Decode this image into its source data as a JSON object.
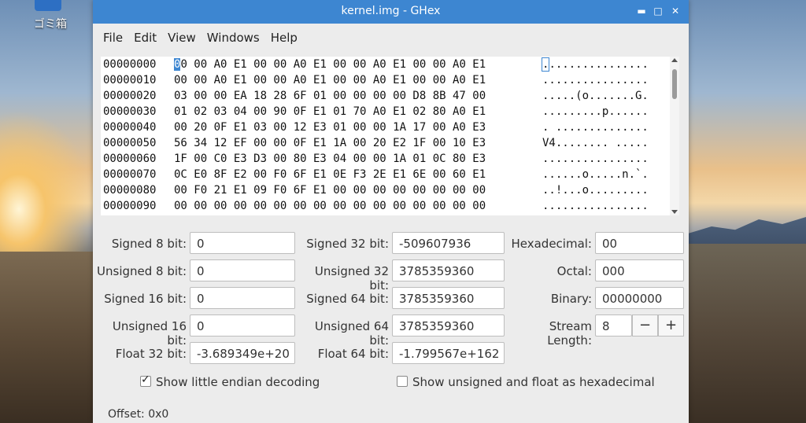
{
  "desktop": {
    "trash_label": "ゴミ箱"
  },
  "window": {
    "title": "kernel.img - GHex",
    "minimize": "▬",
    "maximize": "□",
    "close": "✕"
  },
  "menu": [
    "File",
    "Edit",
    "View",
    "Windows",
    "Help"
  ],
  "hex": {
    "rows": [
      {
        "offset": "00000000",
        "bytes": "00 00 A0 E1 00 00 A0 E1 00 00 A0 E1 00 00 A0 E1",
        "ascii": "................"
      },
      {
        "offset": "00000010",
        "bytes": "00 00 A0 E1 00 00 A0 E1 00 00 A0 E1 00 00 A0 E1",
        "ascii": "................"
      },
      {
        "offset": "00000020",
        "bytes": "03 00 00 EA 18 28 6F 01 00 00 00 00 D8 8B 47 00",
        "ascii": ".....(o.......G."
      },
      {
        "offset": "00000030",
        "bytes": "01 02 03 04 00 90 0F E1 01 70 A0 E1 02 80 A0 E1",
        "ascii": ".........p......"
      },
      {
        "offset": "00000040",
        "bytes": "00 20 0F E1 03 00 12 E3 01 00 00 1A 17 00 A0 E3",
        "ascii": ". .............."
      },
      {
        "offset": "00000050",
        "bytes": "56 34 12 EF 00 00 0F E1 1A 00 20 E2 1F 00 10 E3",
        "ascii": "V4........ ....."
      },
      {
        "offset": "00000060",
        "bytes": "1F 00 C0 E3 D3 00 80 E3 04 00 00 1A 01 0C 80 E3",
        "ascii": "................"
      },
      {
        "offset": "00000070",
        "bytes": "0C E0 8F E2 00 F0 6F E1 0E F3 2E E1 6E 00 60 E1",
        "ascii": "......o.....n.`."
      },
      {
        "offset": "00000080",
        "bytes": "00 F0 21 E1 09 F0 6F E1 00 00 00 00 00 00 00 00",
        "ascii": "..!...o........."
      },
      {
        "offset": "00000090",
        "bytes": "00 00 00 00 00 00 00 00 00 00 00 00 00 00 00 00",
        "ascii": "................"
      }
    ]
  },
  "fields": {
    "signed8": {
      "label": "Signed 8 bit:",
      "value": "0"
    },
    "unsigned8": {
      "label": "Unsigned 8 bit:",
      "value": "0"
    },
    "signed16": {
      "label": "Signed 16 bit:",
      "value": "0"
    },
    "unsigned16": {
      "label": "Unsigned 16 bit:",
      "value": "0"
    },
    "float32": {
      "label": "Float 32 bit:",
      "value": "-3.689349e+20"
    },
    "signed32": {
      "label": "Signed 32 bit:",
      "value": "-509607936"
    },
    "unsigned32": {
      "label": "Unsigned 32 bit:",
      "value": "3785359360"
    },
    "signed64": {
      "label": "Signed 64 bit:",
      "value": "3785359360"
    },
    "unsigned64": {
      "label": "Unsigned 64 bit:",
      "value": "3785359360"
    },
    "float64": {
      "label": "Float 64 bit:",
      "value": "-1.799567e+162"
    },
    "hex": {
      "label": "Hexadecimal:",
      "value": "00"
    },
    "octal": {
      "label": "Octal:",
      "value": "000"
    },
    "binary": {
      "label": "Binary:",
      "value": "00000000"
    },
    "stream": {
      "label": "Stream Length:",
      "value": "8",
      "minus": "−",
      "plus": "+"
    }
  },
  "options": {
    "little_endian": {
      "label": "Show little endian decoding",
      "checked": true
    },
    "unsigned_hex": {
      "label": "Show unsigned and float as hexadecimal",
      "checked": false
    }
  },
  "status": "Offset: 0x0"
}
